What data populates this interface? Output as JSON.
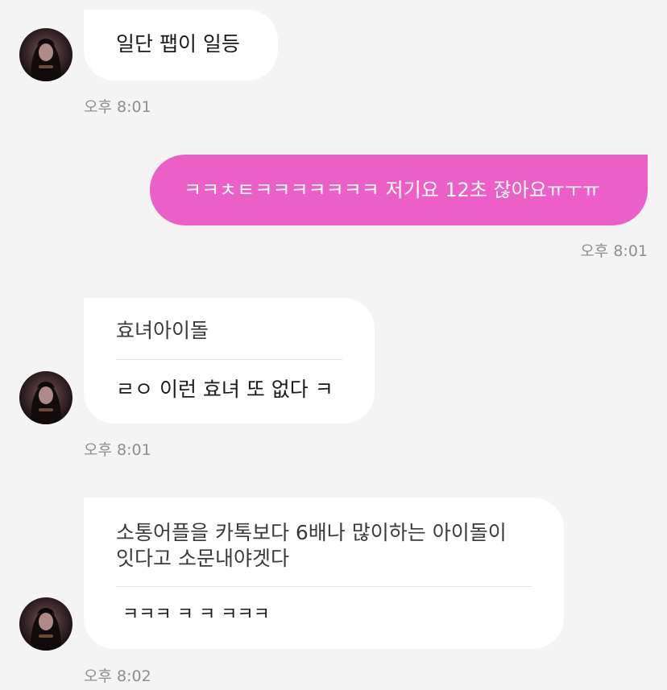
{
  "messages": [
    {
      "text": "일단 팹이 일등",
      "time": "오후 8:01"
    },
    {
      "text": "ㅋㅋㅊㅌㅋㅋㅋㅋㅋㅋㅋ 저기요 12초 잖아요ㅠㅜㅠ",
      "time": "오후 8:01"
    },
    {
      "quote": "효녀아이돌",
      "reply": "ㄹㅇ 이런 효녀 또 없다 ㅋ",
      "time": "오후 8:01"
    },
    {
      "quote_line1": "소통어플을 카톡보다 6배나 많이하는 아이돌이",
      "quote_line2": "잇다고 소문내야겟다",
      "reply": "ㅋㅋㅋ ㅋ ㅋ ㅋㅋㅋ",
      "time": "오후 8:02"
    }
  ],
  "colors": {
    "background": "#f4f4f4",
    "incoming_bubble": "#ffffff",
    "outgoing_bubble": "#ec5fc6",
    "timestamp": "#8f8f8f"
  },
  "icons": {
    "avatar": "profile-photo"
  }
}
